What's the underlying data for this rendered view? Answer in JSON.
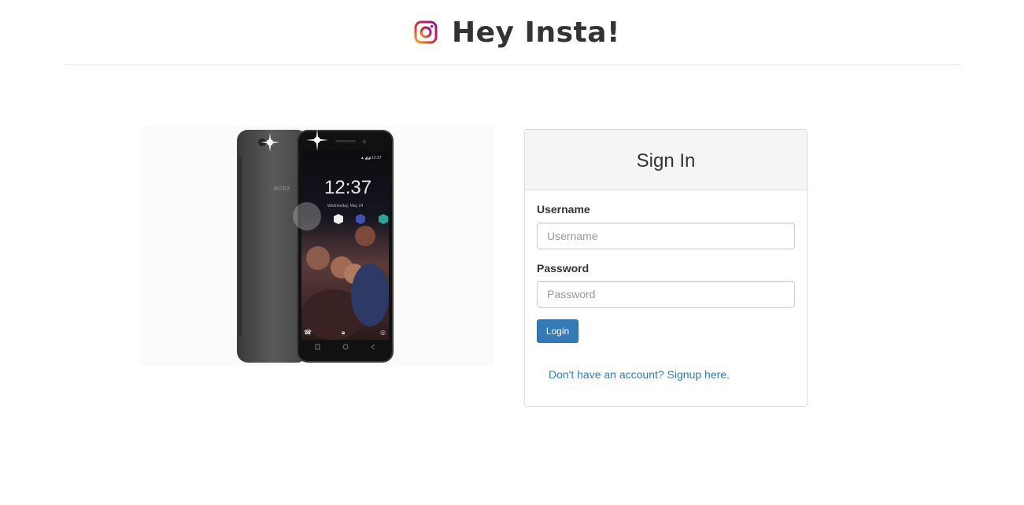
{
  "header": {
    "title": "Hey Insta!",
    "logo_icon": "instagram-icon"
  },
  "illustration": {
    "icon": "smartphone-image",
    "screen_time": "12:37",
    "screen_date": "Wednesday, May 24"
  },
  "signin": {
    "title": "Sign In",
    "username_label": "Username",
    "username_placeholder": "Username",
    "password_label": "Password",
    "password_placeholder": "Password",
    "login_label": "Login",
    "signup_text": "Don't have an account? Signup here."
  },
  "colors": {
    "primary": "#337ab7",
    "panel_heading_bg": "#f5f5f5",
    "border": "#dddddd",
    "text": "#333333"
  }
}
